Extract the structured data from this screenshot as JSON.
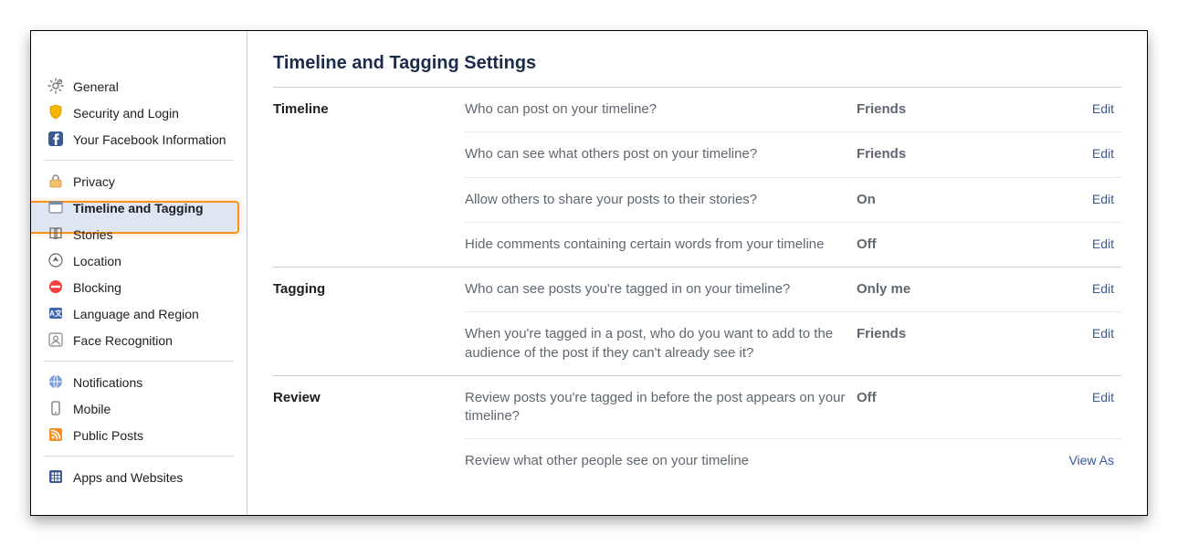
{
  "sidebar": {
    "groups": [
      [
        {
          "icon": "gear",
          "label": "General"
        },
        {
          "icon": "shield",
          "label": "Security and Login"
        },
        {
          "icon": "fb",
          "label": "Your Facebook Information"
        }
      ],
      [
        {
          "icon": "lock",
          "label": "Privacy"
        },
        {
          "icon": "timeline",
          "label": "Timeline and Tagging",
          "active": true
        },
        {
          "icon": "book",
          "label": "Stories"
        },
        {
          "icon": "location",
          "label": "Location"
        },
        {
          "icon": "block",
          "label": "Blocking"
        },
        {
          "icon": "lang",
          "label": "Language and Region"
        },
        {
          "icon": "face",
          "label": "Face Recognition"
        }
      ],
      [
        {
          "icon": "globe",
          "label": "Notifications"
        },
        {
          "icon": "mobile",
          "label": "Mobile"
        },
        {
          "icon": "rss",
          "label": "Public Posts"
        }
      ],
      [
        {
          "icon": "apps",
          "label": "Apps and Websites"
        }
      ]
    ]
  },
  "main": {
    "title": "Timeline and Tagging Settings",
    "edit_label": "Edit",
    "sections": [
      {
        "heading": "Timeline",
        "rows": [
          {
            "label": "Who can post on your timeline?",
            "value": "Friends",
            "action": "Edit"
          },
          {
            "label": "Who can see what others post on your timeline?",
            "value": "Friends",
            "action": "Edit"
          },
          {
            "label": "Allow others to share your posts to their stories?",
            "value": "On",
            "action": "Edit"
          },
          {
            "label": "Hide comments containing certain words from your timeline",
            "value": "Off",
            "action": "Edit"
          }
        ]
      },
      {
        "heading": "Tagging",
        "rows": [
          {
            "label": "Who can see posts you're tagged in on your timeline?",
            "value": "Only me",
            "action": "Edit"
          },
          {
            "label": "When you're tagged in a post, who do you want to add to the audience of the post if they can't already see it?",
            "value": "Friends",
            "action": "Edit"
          }
        ]
      },
      {
        "heading": "Review",
        "rows": [
          {
            "label": "Review posts you're tagged in before the post appears on your timeline?",
            "value": "Off",
            "action": "Edit"
          },
          {
            "label": "Review what other people see on your timeline",
            "value": "",
            "action": "View As"
          }
        ]
      }
    ]
  }
}
